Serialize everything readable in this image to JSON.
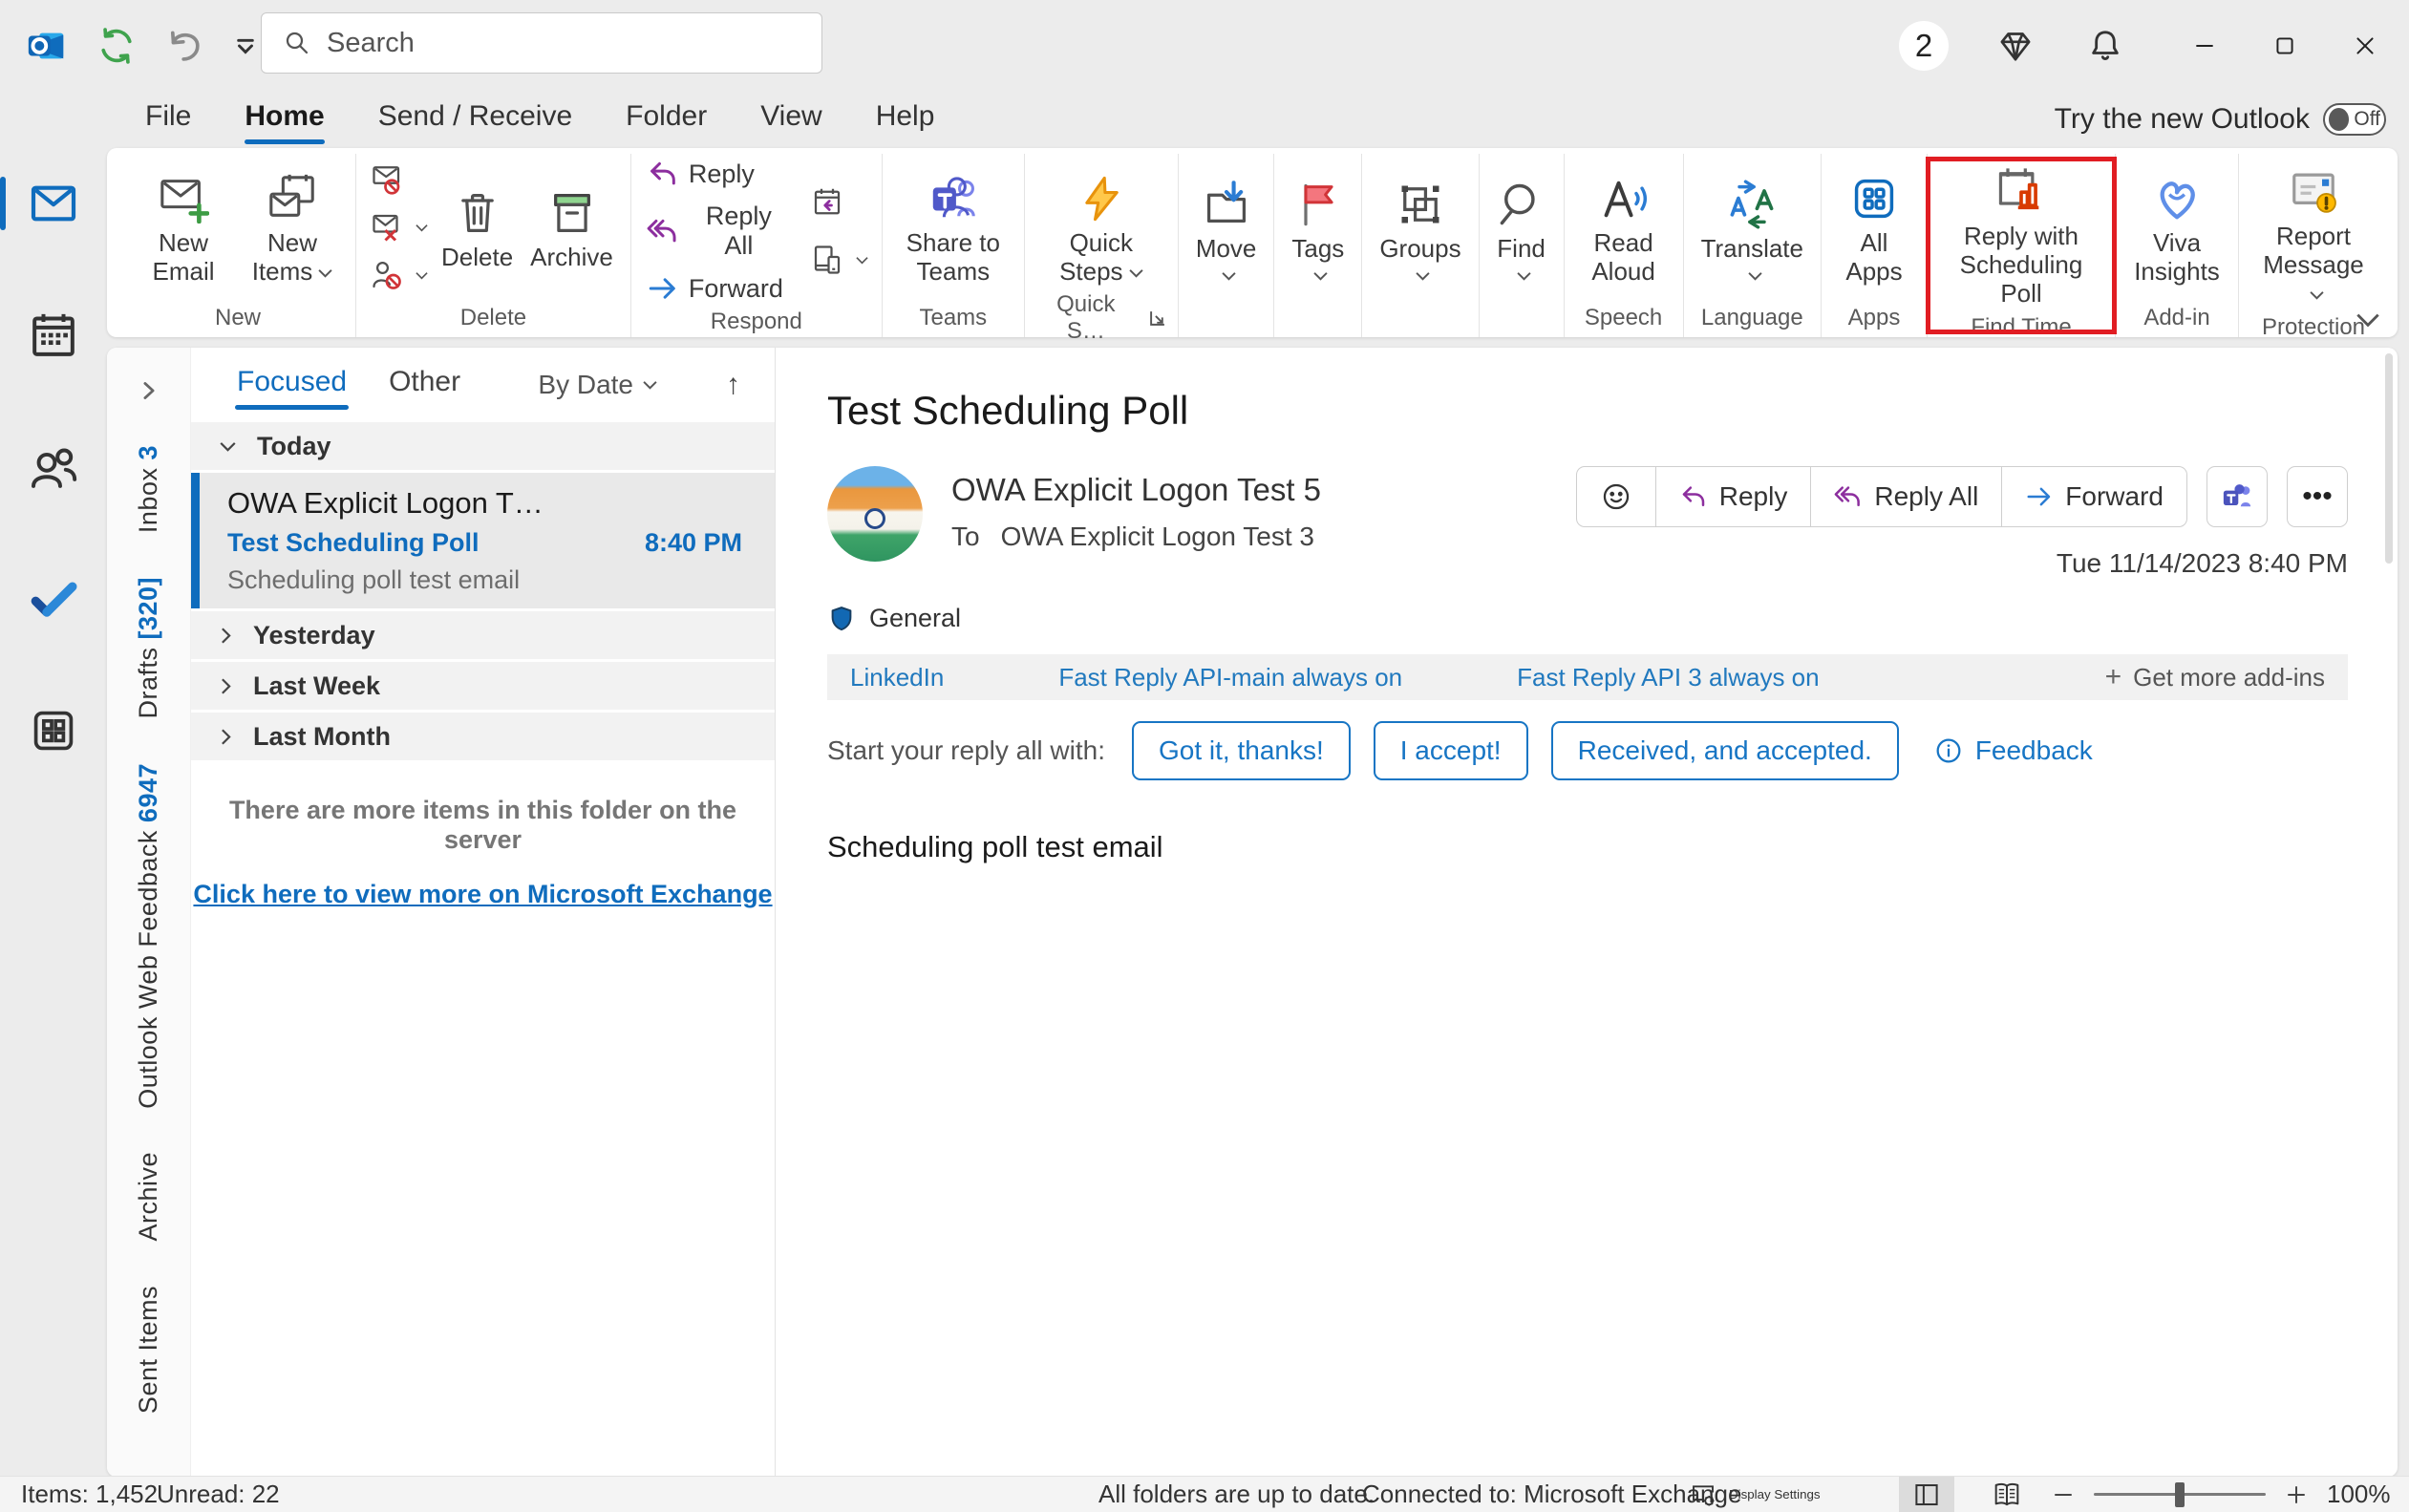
{
  "window": {
    "account_badge": "2"
  },
  "titlebar": {
    "search_placeholder": "Search",
    "try_new_outlook_label": "Try the new Outlook",
    "toggle_state": "Off"
  },
  "menu_tabs": [
    "File",
    "Home",
    "Send / Receive",
    "Folder",
    "View",
    "Help"
  ],
  "icons": {
    "sort_ascending": "↑",
    "overflow": "•••",
    "plus": "+"
  },
  "ribbon": {
    "groups": {
      "new": {
        "label": "New",
        "new_email": "New Email",
        "new_items": "New Items"
      },
      "delete": {
        "label": "Delete",
        "delete": "Delete",
        "archive": "Archive"
      },
      "respond": {
        "label": "Respond",
        "reply": "Reply",
        "reply_all": "Reply All",
        "forward": "Forward"
      },
      "teams": {
        "label": "Teams",
        "share_to_teams": "Share to Teams"
      },
      "quick_steps": {
        "label": "Quick S…",
        "quick_steps": "Quick Steps"
      },
      "move": {
        "move": "Move"
      },
      "tags": {
        "tags": "Tags"
      },
      "groups": {
        "groups": "Groups"
      },
      "find": {
        "find": "Find"
      },
      "speech": {
        "label": "Speech",
        "read_aloud": "Read Aloud"
      },
      "language": {
        "label": "Language",
        "translate": "Translate"
      },
      "apps": {
        "label": "Apps",
        "all_apps": "All Apps"
      },
      "find_time": {
        "label": "Find Time",
        "scheduling_poll": "Reply with Scheduling Poll"
      },
      "addin": {
        "label": "Add-in",
        "viva_insights": "Viva Insights"
      },
      "protection": {
        "label": "Protection",
        "report_message": "Report Message"
      }
    },
    "highlight_color": "#e11d23"
  },
  "folder_rail": {
    "items": [
      {
        "name": "Inbox ",
        "count": "3"
      },
      {
        "name": "Drafts ",
        "count": "[320]"
      },
      {
        "name": "Outlook Web Feedback ",
        "count": "6947"
      },
      {
        "name": "Archive",
        "count": ""
      },
      {
        "name": "Sent Items",
        "count": ""
      }
    ]
  },
  "message_list": {
    "tab_focused": "Focused",
    "tab_other": "Other",
    "sort_label": "By Date",
    "group_today": "Today",
    "group_yesterday": "Yesterday",
    "group_last_week": "Last Week",
    "group_last_month": "Last Month",
    "message": {
      "sender": "OWA Explicit Logon T…",
      "subject": "Test Scheduling Poll",
      "time": "8:40 PM",
      "preview": "Scheduling poll test email"
    },
    "more_items_note": "There are more items in this folder on the server",
    "view_more_link": "Click here to view more on Microsoft Exchange"
  },
  "reading_pane": {
    "subject": "Test Scheduling Poll",
    "sender": "OWA Explicit Logon Test 5",
    "to_label": "To",
    "recipient": "OWA Explicit Logon Test 3",
    "sensitivity": "General",
    "date": "Tue 11/14/2023 8:40 PM",
    "actions": {
      "reply": "Reply",
      "reply_all": "Reply All",
      "forward": "Forward"
    },
    "addins": [
      "LinkedIn",
      "Fast Reply API-main always on",
      "Fast Reply API 3 always on"
    ],
    "get_more_addins": "Get more add-ins",
    "suggested": {
      "label": "Start your reply all with:",
      "option1": "Got it, thanks!",
      "option2": "I accept!",
      "option3": "Received, and accepted.",
      "feedback": "Feedback"
    },
    "body": "Scheduling poll test email"
  },
  "status_bar": {
    "items": "Items: 1,452",
    "unread": "Unread: 22",
    "folders_status": "All folders are up to date.",
    "connection": "Connected to: Microsoft Exchange",
    "display_settings": "Display Settings",
    "zoom_level": "100%"
  }
}
